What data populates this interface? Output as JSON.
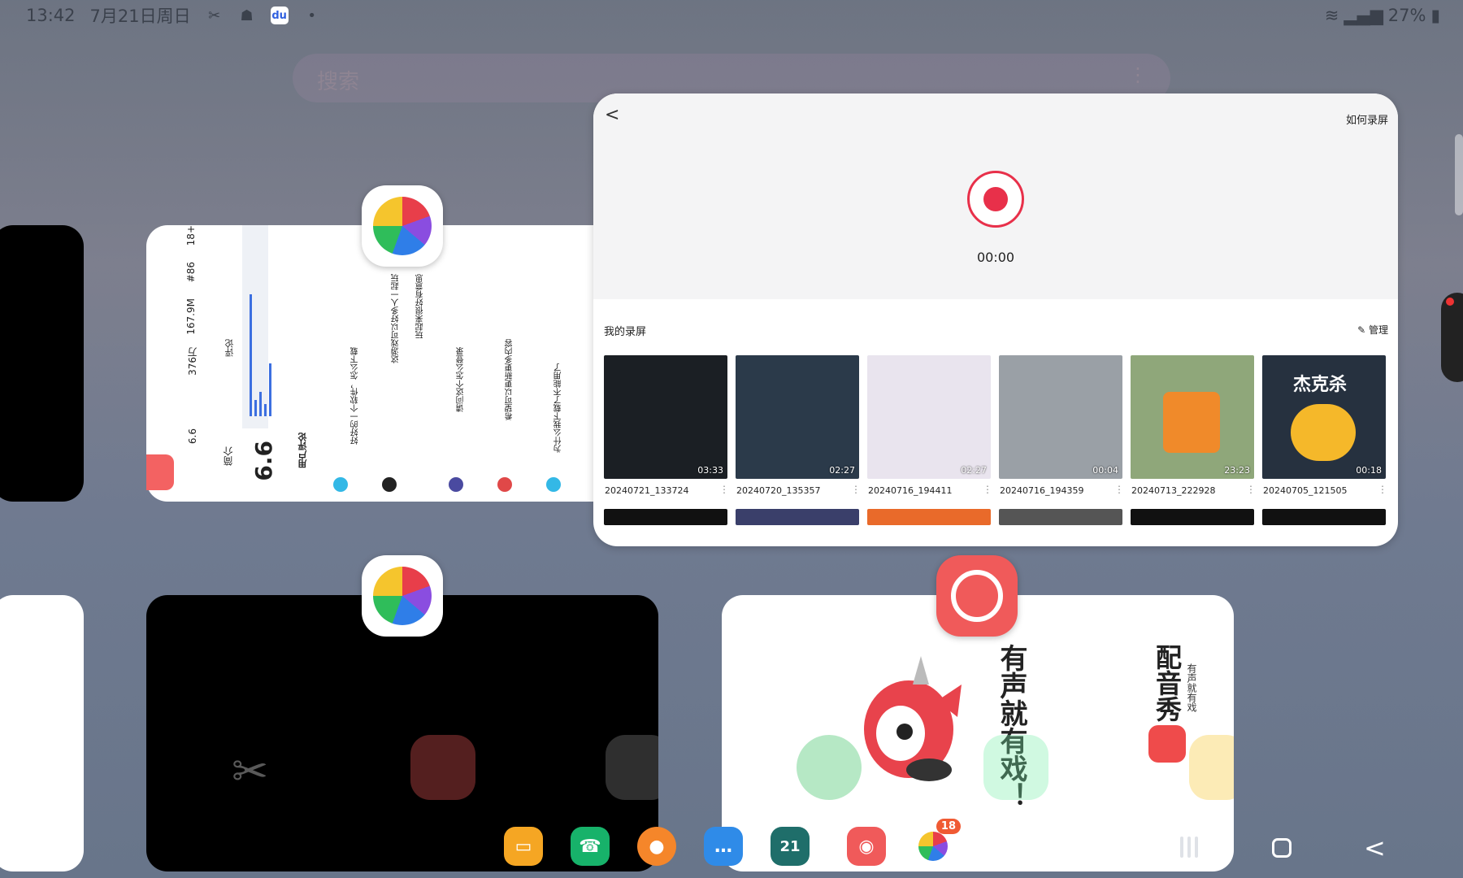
{
  "status_bar": {
    "time": "13:42",
    "date": "7月21日周日",
    "icons": [
      "capcut-icon",
      "android-icon",
      "baidu-icon",
      "dot-icon"
    ],
    "battery": "27%",
    "signal_icons": [
      "wifi-icon",
      "signal-icon",
      "battery-icon"
    ]
  },
  "search": {
    "placeholder": "搜索",
    "more": "⋮"
  },
  "recorder": {
    "back": "<",
    "how_to": "如何录屏",
    "timer": "00:00",
    "section_title": "我的录屏",
    "manage": "✎ 管理",
    "recordings": [
      {
        "name": "20240721_133724",
        "duration": "03:33"
      },
      {
        "name": "20240720_135357",
        "duration": "02:27"
      },
      {
        "name": "20240716_194411",
        "duration": "02:27"
      },
      {
        "name": "20240716_194359",
        "duration": "00:04"
      },
      {
        "name": "20240713_222928",
        "duration": "23:23"
      },
      {
        "name": "20240705_121505",
        "duration": "00:18"
      }
    ],
    "thumb_overlay_text": "杰克杀"
  },
  "stats_card": {
    "rating": "6.6",
    "metric1": "376万",
    "metric2": "167.9M",
    "metric3": "#86",
    "metric4": "18+",
    "intro": "简介",
    "reviews": "用户评论",
    "comments_label": "评论",
    "review_lines": [
      "好好的一个软件，怎么下载",
      "这游戏可以好多人一起玩",
      "玩起来很好有意思",
      "请问这个怎么登录",
      "希望可以更新更多内容",
      "为什么我下载了不能用了"
    ]
  },
  "voice_card": {
    "slogan": "有声就有戏！",
    "brand": "配音秀",
    "brand_sub": "有声就有戏"
  },
  "dock": {
    "apps": [
      {
        "name": "files",
        "color": "#f5a623",
        "glyph": "▭"
      },
      {
        "name": "phone",
        "color": "#17b26a",
        "glyph": "☎"
      },
      {
        "name": "contacts",
        "color": "#f5862a",
        "glyph": "●"
      },
      {
        "name": "messages",
        "color": "#2f8be8",
        "glyph": "…"
      },
      {
        "name": "calendar",
        "color": "#1f6e6a",
        "glyph": "21"
      },
      {
        "name": "voice-show",
        "color": "#f05a5a",
        "glyph": "◉"
      },
      {
        "name": "app-store",
        "color": "#ffffff",
        "glyph": "",
        "badge": "18"
      }
    ]
  },
  "nav": {
    "back": "<"
  }
}
